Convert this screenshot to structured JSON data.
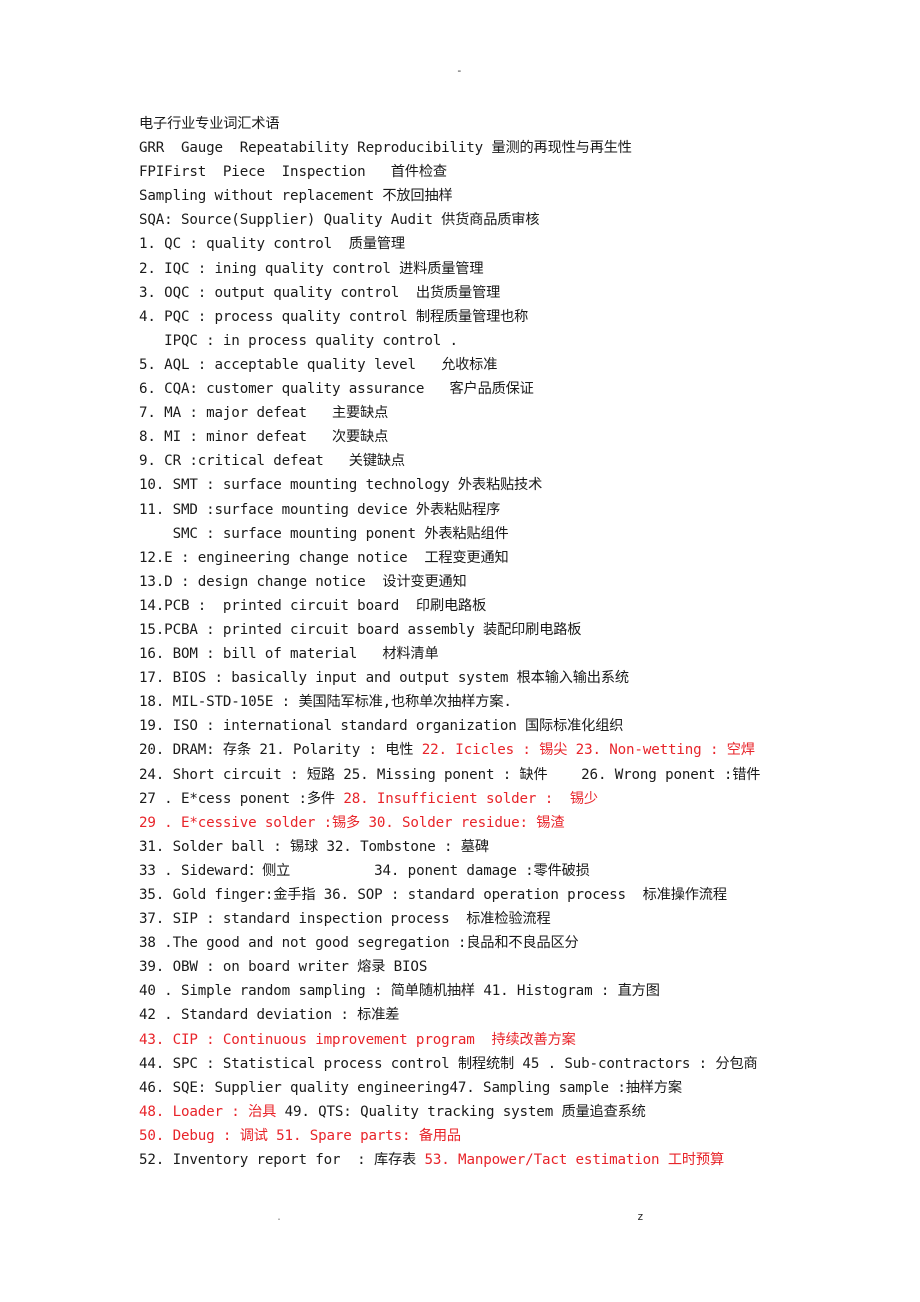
{
  "header": {
    "mark": "-"
  },
  "document": {
    "title": "电子行业专业词汇术语",
    "lines": [
      {
        "segments": [
          {
            "text": "电子行业专业词汇术语",
            "color": "black"
          }
        ]
      },
      {
        "segments": [
          {
            "text": "GRR  Gauge  Repeatability Reproducibility 量测的再现性与再生性",
            "color": "black"
          }
        ]
      },
      {
        "segments": [
          {
            "text": "FPIFirst  Piece  Inspection   首件检查",
            "color": "black"
          }
        ]
      },
      {
        "segments": [
          {
            "text": "Sampling without replacement 不放回抽样",
            "color": "black"
          }
        ]
      },
      {
        "segments": [
          {
            "text": "SQA: Source(Supplier) Quality Audit 供货商品质审核",
            "color": "black"
          }
        ]
      },
      {
        "segments": [
          {
            "text": "1. QC : quality control  质量管理",
            "color": "black"
          }
        ]
      },
      {
        "segments": [
          {
            "text": "2. IQC : ining quality control 进料质量管理",
            "color": "black"
          }
        ]
      },
      {
        "segments": [
          {
            "text": "3. OQC : output quality control  出货质量管理",
            "color": "black"
          }
        ]
      },
      {
        "segments": [
          {
            "text": "4. PQC : process quality control 制程质量管理也称",
            "color": "black"
          }
        ]
      },
      {
        "segments": [
          {
            "text": "   IPQC : in process quality control .",
            "color": "black"
          }
        ]
      },
      {
        "segments": [
          {
            "text": "5. AQL : acceptable quality level   允收标准",
            "color": "black"
          }
        ]
      },
      {
        "segments": [
          {
            "text": "6. CQA: customer quality assurance   客户品质保证",
            "color": "black"
          }
        ]
      },
      {
        "segments": [
          {
            "text": "7. MA : major defeat   主要缺点",
            "color": "black"
          }
        ]
      },
      {
        "segments": [
          {
            "text": "8. MI : minor defeat   次要缺点",
            "color": "black"
          }
        ]
      },
      {
        "segments": [
          {
            "text": "9. CR :critical defeat   关键缺点",
            "color": "black"
          }
        ]
      },
      {
        "segments": [
          {
            "text": "10. SMT : surface mounting technology 外表粘贴技术",
            "color": "black"
          }
        ]
      },
      {
        "segments": [
          {
            "text": "11. SMD :surface mounting device 外表粘贴程序",
            "color": "black"
          }
        ]
      },
      {
        "segments": [
          {
            "text": "    SMC : surface mounting ponent 外表粘贴组件",
            "color": "black"
          }
        ]
      },
      {
        "segments": [
          {
            "text": "12.E : engineering change notice  工程变更通知",
            "color": "black"
          }
        ]
      },
      {
        "segments": [
          {
            "text": "13.D : design change notice  设计变更通知",
            "color": "black"
          }
        ]
      },
      {
        "segments": [
          {
            "text": "14.PCB :  printed circuit board  印刷电路板",
            "color": "black"
          }
        ]
      },
      {
        "segments": [
          {
            "text": "15.PCBA : printed circuit board assembly 装配印刷电路板",
            "color": "black"
          }
        ]
      },
      {
        "segments": [
          {
            "text": "16. BOM : bill of material   材料清单",
            "color": "black"
          }
        ]
      },
      {
        "segments": [
          {
            "text": "17. BIOS : basically input and output system 根本输入输出系统",
            "color": "black"
          }
        ]
      },
      {
        "segments": [
          {
            "text": "18. MIL-STD-105E : 美国陆军标准,也称单次抽样方案.",
            "color": "black"
          }
        ]
      },
      {
        "segments": [
          {
            "text": "19. ISO : international standard organization 国际标准化组织",
            "color": "black"
          }
        ]
      },
      {
        "segments": [
          {
            "text": "20. DRAM: 存条 21. Polarity : 电性 ",
            "color": "black"
          },
          {
            "text": "22. Icicles : 锡尖 23. Non-wetting : 空焊",
            "color": "red"
          }
        ]
      },
      {
        "segments": [
          {
            "text": "24. Short circuit : 短路 25. Missing ponent : 缺件    26. Wrong ponent :错件",
            "color": "black"
          }
        ]
      },
      {
        "segments": [
          {
            "text": "27 . E*cess ponent :多件 ",
            "color": "black"
          },
          {
            "text": "28. Insufficient solder :  锡少",
            "color": "red"
          }
        ]
      },
      {
        "segments": [
          {
            "text": "29 . E*cessive solder :锡多 30. Solder residue: 锡渣",
            "color": "red"
          }
        ]
      },
      {
        "segments": [
          {
            "text": "31. Solder ball : 锡球 32. Tombstone : 墓碑",
            "color": "black"
          }
        ]
      },
      {
        "segments": [
          {
            "text": "33 . Sideward：侧立          34. ponent damage :零件破损",
            "color": "black"
          }
        ]
      },
      {
        "segments": [
          {
            "text": "35. Gold finger:金手指 36. SOP : standard operation process  标准操作流程",
            "color": "black"
          }
        ]
      },
      {
        "segments": [
          {
            "text": "37. SIP : standard inspection process  标准检验流程",
            "color": "black"
          }
        ]
      },
      {
        "segments": [
          {
            "text": "38 .The good and not good segregation :良品和不良品区分",
            "color": "black"
          }
        ]
      },
      {
        "segments": [
          {
            "text": "39. OBW : on board writer 熔录 BIOS",
            "color": "black"
          }
        ]
      },
      {
        "segments": [
          {
            "text": "40 . Simple random sampling : 简单随机抽样 41. Histogram : 直方图",
            "color": "black"
          }
        ]
      },
      {
        "segments": [
          {
            "text": "42 . Standard deviation : 标准差",
            "color": "black"
          }
        ]
      },
      {
        "segments": [
          {
            "text": "43. CIP : Continuous improvement program  持续改善方案",
            "color": "red"
          }
        ]
      },
      {
        "segments": [
          {
            "text": "44. SPC : Statistical process control 制程统制 45 . Sub-contractors : 分包商",
            "color": "black"
          }
        ]
      },
      {
        "segments": [
          {
            "text": "46. SQE: Supplier quality engineering47. Sampling sample :抽样方案",
            "color": "black"
          }
        ]
      },
      {
        "segments": [
          {
            "text": "48. Loader : 治具 ",
            "color": "red"
          },
          {
            "text": "49. QTS: Quality tracking system 质量追查系统",
            "color": "black"
          }
        ]
      },
      {
        "segments": [
          {
            "text": "50. Debug : 调试 51. Spare parts: 备用品",
            "color": "red"
          }
        ]
      },
      {
        "segments": [
          {
            "text": "52. Inventory report for  : 库存表 ",
            "color": "black"
          },
          {
            "text": "53. Manpower/Tact estimation 工时预算",
            "color": "red"
          }
        ]
      }
    ]
  },
  "footer": {
    "left_mark": ".",
    "right_mark": "z"
  },
  "colors": {
    "text": "#1a1a1a",
    "highlight_red": "#e8242a",
    "background": "#ffffff"
  }
}
